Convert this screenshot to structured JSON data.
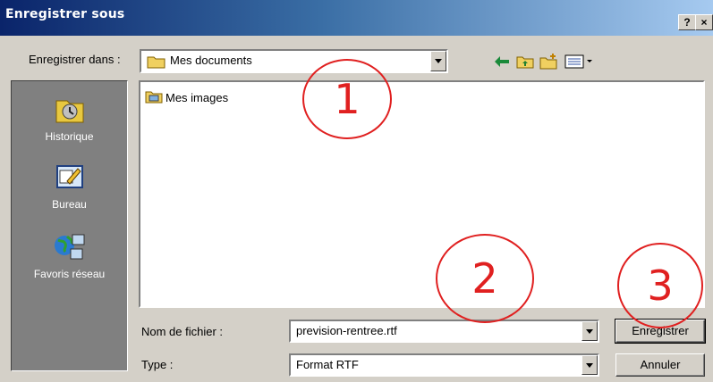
{
  "window": {
    "title": "Enregistrer sous",
    "help_button": "?",
    "close_button": "×"
  },
  "toolbar": {
    "save_in_label": "Enregistrer dans :",
    "save_in_value": "Mes documents",
    "icons": [
      "back-arrow-icon",
      "up-folder-icon",
      "new-folder-icon",
      "view-menu-icon"
    ]
  },
  "places": [
    {
      "label": "Historique",
      "icon": "history-icon"
    },
    {
      "label": "Bureau",
      "icon": "desktop-icon"
    },
    {
      "label": "Favoris réseau",
      "icon": "network-places-icon"
    }
  ],
  "files": [
    {
      "name": "Mes images",
      "icon": "folder-icon"
    }
  ],
  "form": {
    "filename_label": "Nom de fichier :",
    "filename_value": "prevision-rentree.rtf",
    "type_label": "Type :",
    "type_value": "Format RTF"
  },
  "buttons": {
    "save": "Enregistrer",
    "cancel": "Annuler"
  },
  "annotations": [
    "1",
    "2",
    "3"
  ],
  "colors": {
    "title_start": "#0a246a",
    "title_end": "#a6caf0",
    "annotation": "#e02020",
    "places_bg": "#808080"
  }
}
